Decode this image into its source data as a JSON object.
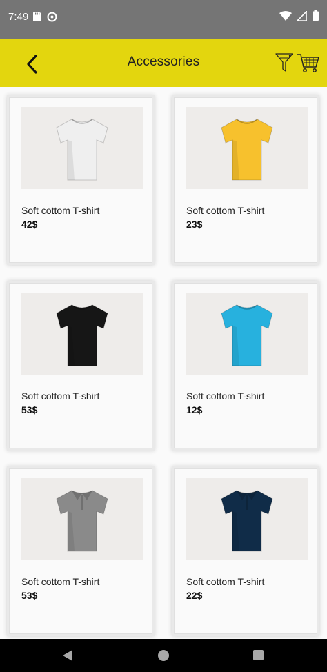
{
  "status_bar": {
    "time": "7:49",
    "left_icons": [
      "sd-card-icon",
      "data-saver-icon"
    ],
    "right_icons": [
      "wifi-icon",
      "signal-icon",
      "battery-icon"
    ]
  },
  "app_bar": {
    "title": "Accessories",
    "back_icon": "chevron-left-icon",
    "filter_icon": "filter-icon",
    "cart_icon": "cart-icon",
    "background": "#e3d60e"
  },
  "products": [
    {
      "name": "Soft cottom T-shirt",
      "price": "42$",
      "shirt_color": "#efefef",
      "style": "tshirt"
    },
    {
      "name": "Soft cottom T-shirt",
      "price": "23$",
      "shirt_color": "#f7c12d",
      "style": "tshirt"
    },
    {
      "name": "Soft cottom T-shirt",
      "price": "53$",
      "shirt_color": "#161616",
      "style": "tshirt"
    },
    {
      "name": "Soft cottom T-shirt",
      "price": "12$",
      "shirt_color": "#27b1de",
      "style": "tshirt"
    },
    {
      "name": "Soft cottom T-shirt",
      "price": "53$",
      "shirt_color": "#8a8a8a",
      "style": "polo"
    },
    {
      "name": "Soft cottom T-shirt",
      "price": "22$",
      "shirt_color": "#102c48",
      "style": "polo"
    }
  ],
  "nav_bar": {
    "back_icon": "nav-back-icon",
    "home_icon": "nav-home-icon",
    "recents_icon": "nav-recents-icon"
  }
}
